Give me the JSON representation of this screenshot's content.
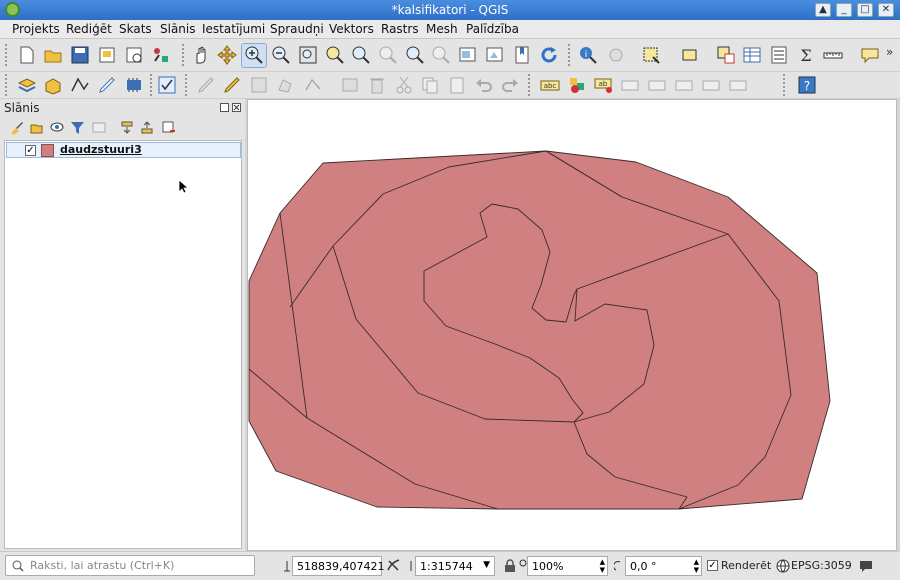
{
  "window": {
    "title": "*kalsifikatori - QGIS"
  },
  "menu": [
    "Projekts",
    "Rediģēt",
    "Skats",
    "Slānis",
    "Iestatījumi",
    "Spraudņi",
    "Vektors",
    "Rastrs",
    "Mesh",
    "Palīdzība"
  ],
  "layers_panel": {
    "title": "Slānis",
    "layers": [
      {
        "name": "daudzstuuri3",
        "checked": true,
        "color": "#d08080"
      }
    ]
  },
  "status": {
    "search_placeholder": "Raksti, lai atrastu (Ctrl+K)",
    "coordinate": "518839,407421",
    "scale": "1:315744",
    "magnifier": "100%",
    "rotation": "0,0 °",
    "render_label": "Renderēt",
    "crs": "EPSG:3059"
  },
  "toolbar_overflow": "»",
  "colors": {
    "polygon_fill": "#d08080",
    "polygon_stroke": "#3a2a2a",
    "accent": "#2d6fc7"
  }
}
